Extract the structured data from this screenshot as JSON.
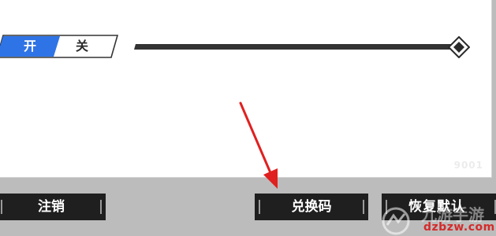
{
  "toggle": {
    "on_label": "开",
    "off_label": "关",
    "selected": "on",
    "accent_color": "#2f74e6"
  },
  "slider": {
    "value_fraction": 1.0,
    "thumb_icon": "diamond-handle-icon"
  },
  "panel": {
    "watermark_text": "9001"
  },
  "buttons": {
    "logout_label": "注销",
    "redeem_label": "兑换码",
    "reset_label": "恢复默认"
  },
  "annotation": {
    "arrow_color": "#e02020",
    "target": "redeem-code-button"
  },
  "watermark": {
    "site_name": "九游手游",
    "url": "dzbzw.com",
    "logo_icon": "site-logo-icon"
  }
}
